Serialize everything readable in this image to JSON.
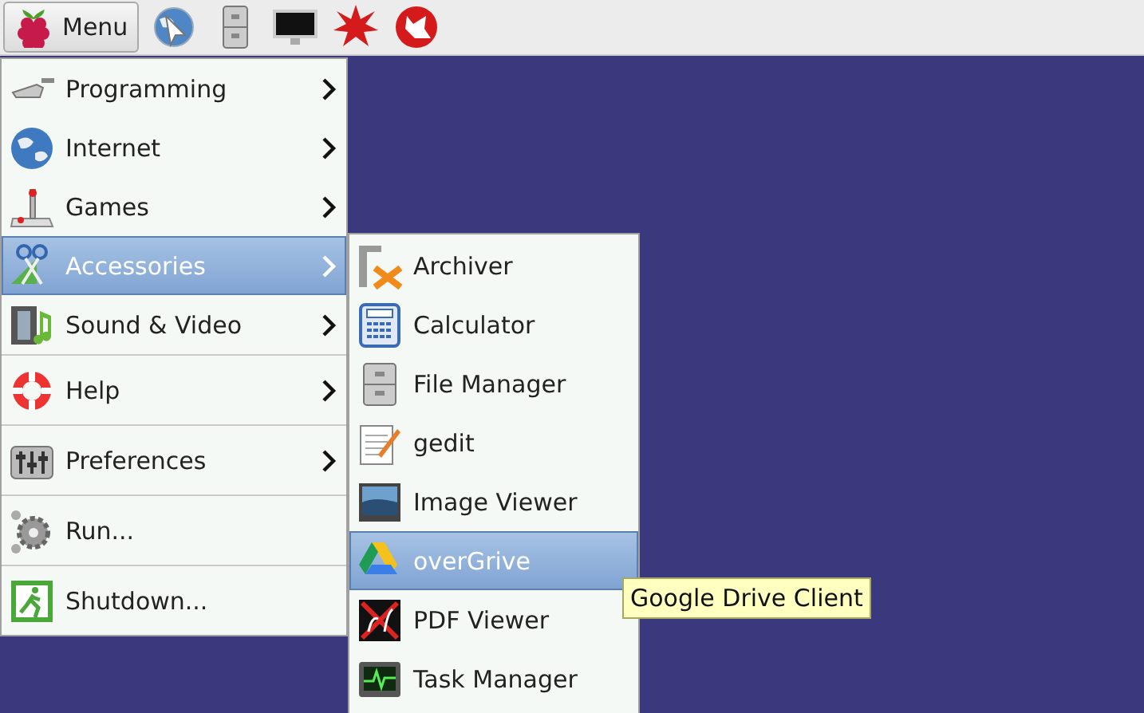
{
  "taskbar": {
    "menu_button": {
      "label": "Menu"
    }
  },
  "main_menu": [
    {
      "label": "Programming",
      "has_submenu": true,
      "selected": false
    },
    {
      "label": "Internet",
      "has_submenu": true,
      "selected": false
    },
    {
      "label": "Games",
      "has_submenu": true,
      "selected": false
    },
    {
      "label": "Accessories",
      "has_submenu": true,
      "selected": true
    },
    {
      "label": "Sound & Video",
      "has_submenu": true,
      "selected": false
    },
    {
      "label": "Help",
      "has_submenu": true,
      "selected": false
    },
    {
      "label": "Preferences",
      "has_submenu": true,
      "selected": false
    },
    {
      "label": "Run...",
      "has_submenu": false,
      "selected": false
    },
    {
      "label": "Shutdown...",
      "has_submenu": false,
      "selected": false
    }
  ],
  "submenu": [
    {
      "label": "Archiver",
      "selected": false
    },
    {
      "label": "Calculator",
      "selected": false
    },
    {
      "label": "File Manager",
      "selected": false
    },
    {
      "label": "gedit",
      "selected": false
    },
    {
      "label": "Image Viewer",
      "selected": false
    },
    {
      "label": "overGrive",
      "selected": true
    },
    {
      "label": "PDF Viewer",
      "selected": false
    },
    {
      "label": "Task Manager",
      "selected": false
    }
  ],
  "tooltip": {
    "text": "Google Drive Client"
  }
}
